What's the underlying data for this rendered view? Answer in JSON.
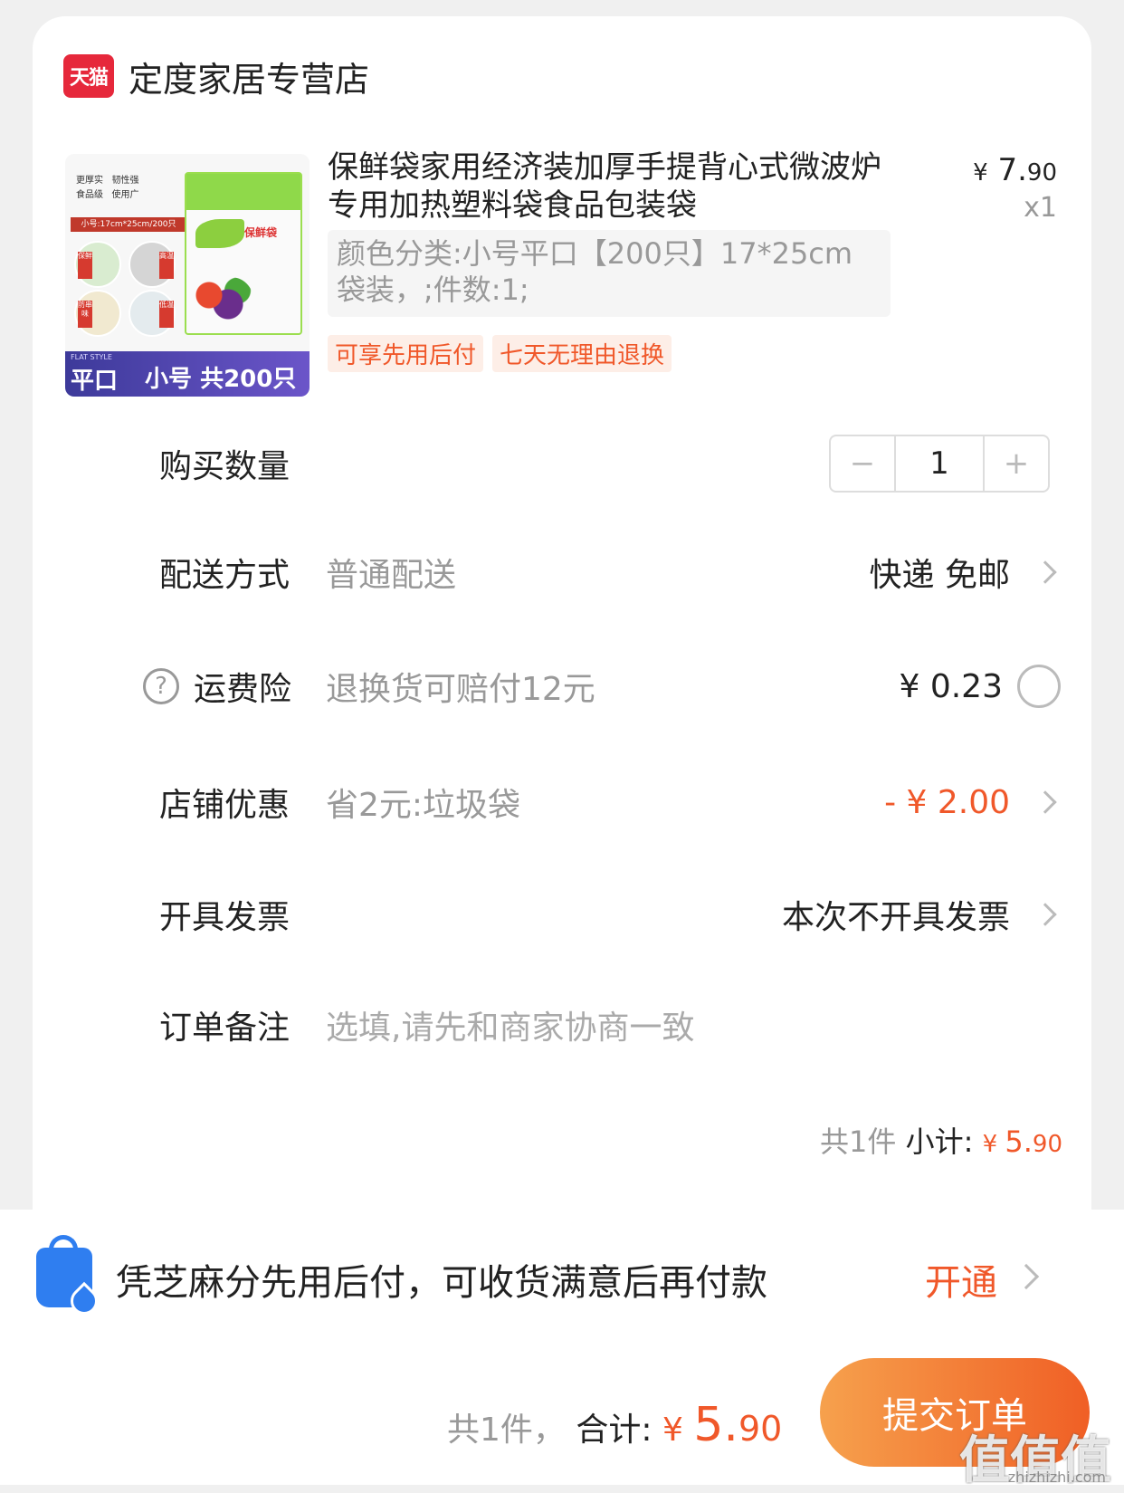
{
  "shop": {
    "logo_text": "天猫",
    "name": "定度家居专营店"
  },
  "product": {
    "thumb": {
      "flat_style": "FLAT STYLE",
      "flat_label": "平口",
      "count_label": "小号 共200只",
      "tags": [
        "更厚实",
        "韧性强",
        "食品级",
        "使用广"
      ],
      "size_label": "小号:17cm*25cm/200只",
      "bag_brand": "保鲜袋",
      "circle_labels": [
        "保鲜",
        "高温",
        "防串味",
        "低温"
      ]
    },
    "title": "保鲜袋家用经济装加厚手提背心式微波炉专用加热塑料袋食品包装袋",
    "price_yen": "¥",
    "price_int": "7.",
    "price_dec": "90",
    "quantity": "x1",
    "sku": "颜色分类:小号平口【200只】17*25cm袋装，;件数:1;",
    "badges": [
      "可享先用后付",
      "七天无理由退换"
    ]
  },
  "rows": {
    "quantity_label": "购买数量",
    "quantity_value": "1",
    "stepper_minus": "−",
    "stepper_plus": "+",
    "delivery_label": "配送方式",
    "delivery_sub": "普通配送",
    "delivery_value": "快递 免邮",
    "insurance_icon": "?",
    "insurance_label": "运费险",
    "insurance_sub": "退换货可赔付12元",
    "insurance_value": "¥ 0.23",
    "discount_label": "店铺优惠",
    "discount_sub": "省2元:垃圾袋",
    "discount_value": "- ¥ 2.00",
    "invoice_label": "开具发票",
    "invoice_value": "本次不开具发票",
    "note_label": "订单备注",
    "note_placeholder": "选填,请先和商家协商一致"
  },
  "subtotal": {
    "count": "共1件",
    "label": "小计:",
    "yen": "¥ ",
    "int": "5.",
    "dec": "90"
  },
  "credit": {
    "text": "凭芝麻分先用后付，可收货满意后再付款",
    "action": "开通"
  },
  "footer": {
    "count": "共1件，",
    "label": "合计:",
    "yen": "¥ ",
    "int": "5.",
    "dec": "90",
    "submit_label": "提交订单",
    "watermark": "值值值",
    "watermark_url": "zhizhizhi.com"
  },
  "colors": {
    "accent": "#f0582a",
    "tmall_red": "#e6283b",
    "credit_blue": "#2f7ef0"
  }
}
